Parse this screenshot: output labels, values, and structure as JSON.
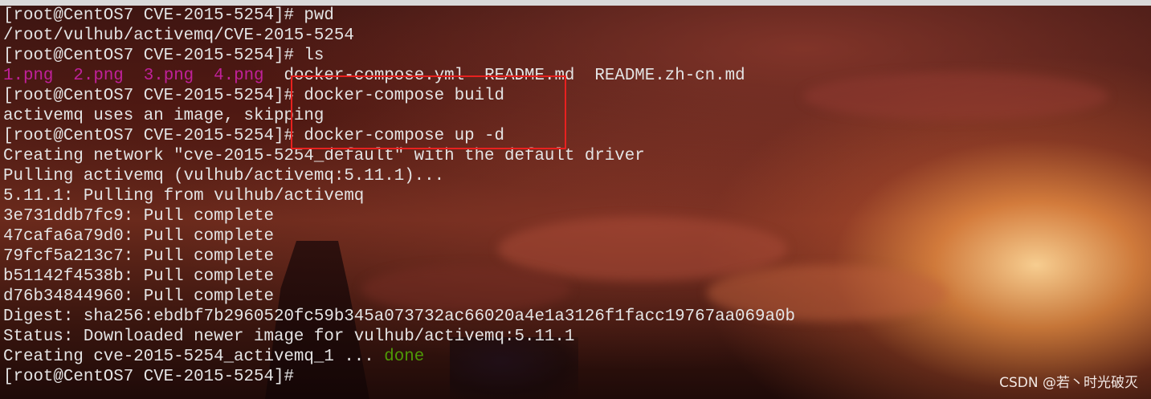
{
  "terminal": {
    "lines": [
      [
        {
          "text": "[root@CentOS7 CVE-2015-5254]# pwd"
        }
      ],
      [
        {
          "text": "/root/vulhub/activemq/CVE-2015-5254"
        }
      ],
      [
        {
          "text": "[root@CentOS7 CVE-2015-5254]# ls"
        }
      ],
      [
        {
          "text": "1.png",
          "color": "magenta"
        },
        {
          "text": "  "
        },
        {
          "text": "2.png",
          "color": "magenta"
        },
        {
          "text": "  "
        },
        {
          "text": "3.png",
          "color": "magenta"
        },
        {
          "text": "  "
        },
        {
          "text": "4.png",
          "color": "magenta"
        },
        {
          "text": "  docker-compose.yml  README.md  README.zh-cn.md"
        }
      ],
      [
        {
          "text": "[root@CentOS7 CVE-2015-5254]# docker-compose build"
        }
      ],
      [
        {
          "text": "activemq uses an image, skipping"
        }
      ],
      [
        {
          "text": "[root@CentOS7 CVE-2015-5254]# docker-compose up -d"
        }
      ],
      [
        {
          "text": "Creating network \"cve-2015-5254_default\" with the default driver"
        }
      ],
      [
        {
          "text": "Pulling activemq (vulhub/activemq:5.11.1)..."
        }
      ],
      [
        {
          "text": "5.11.1: Pulling from vulhub/activemq"
        }
      ],
      [
        {
          "text": "3e731ddb7fc9: Pull complete"
        }
      ],
      [
        {
          "text": "47cafa6a79d0: Pull complete"
        }
      ],
      [
        {
          "text": "79fcf5a213c7: Pull complete"
        }
      ],
      [
        {
          "text": "b51142f4538b: Pull complete"
        }
      ],
      [
        {
          "text": "d76b34844960: Pull complete"
        }
      ],
      [
        {
          "text": "Digest: sha256:ebdbf7b2960520fc59b345a073732ac66020a4e1a3126f1facc19767aa069a0b"
        }
      ],
      [
        {
          "text": "Status: Downloaded newer image for vulhub/activemq:5.11.1"
        }
      ],
      [
        {
          "text": "Creating cve-2015-5254_activemq_1 ... "
        },
        {
          "text": "done",
          "color": "green"
        }
      ],
      [
        {
          "text": "[root@CentOS7 CVE-2015-5254]#"
        }
      ]
    ]
  },
  "watermark": "CSDN @若丶时光破灭",
  "colors": {
    "text": "#e4e4e4",
    "magenta": "#c0219a",
    "green": "#4e9a06",
    "highlight": "#e8211f"
  }
}
